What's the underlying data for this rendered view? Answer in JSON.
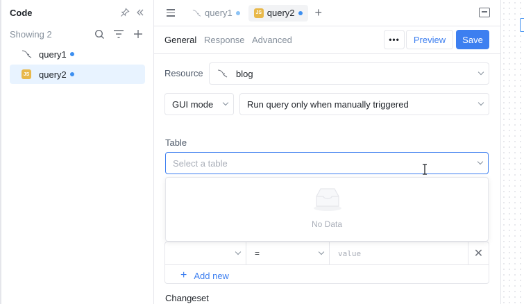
{
  "sidebar": {
    "title": "Code",
    "showing": "Showing 2",
    "queries": [
      {
        "name": "query1",
        "icon": "mysql-dolphin-icon",
        "active": false
      },
      {
        "name": "query2",
        "icon": "js-badge-icon",
        "badge": "JS",
        "active": true
      }
    ]
  },
  "tabs": {
    "items": [
      {
        "label": "query1",
        "icon": "mysql-dolphin-icon",
        "badge": ""
      },
      {
        "label": "query2",
        "icon": "js-badge-icon",
        "badge": "JS"
      }
    ]
  },
  "editor": {
    "subtabs": [
      "General",
      "Response",
      "Advanced"
    ],
    "more_label": "•••",
    "preview_label": "Preview",
    "save_label": "Save",
    "resource_label": "Resource",
    "resource_value": "blog",
    "mode_value": "GUI mode",
    "trigger_value": "Run query only when manually triggered",
    "table_label": "Table",
    "table_placeholder": "Select a table",
    "dropdown_empty": "No Data",
    "filter": {
      "operator": "=",
      "value_placeholder": "value",
      "remove": "✕"
    },
    "add_new_label": "Add new",
    "changeset_label": "Changeset"
  },
  "colors": {
    "accent": "#3d7ff0",
    "dot": "#3d8ff0",
    "js_badge": "#e8b84a",
    "active_bg": "#e8f3ff"
  }
}
